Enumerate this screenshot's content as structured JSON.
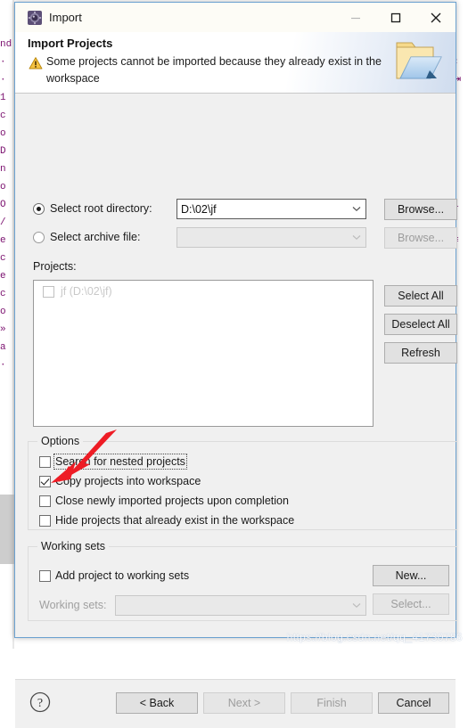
{
  "window": {
    "title": "Import",
    "icon": "eclipse-import-icon",
    "controls": {
      "minimize": "minimize-icon",
      "maximize": "maximize-icon",
      "close": "close-icon"
    }
  },
  "header": {
    "title": "Import Projects",
    "message": "Some projects cannot be imported because they already exist in the workspace",
    "warning_icon": "warning-triangle-icon",
    "banner_icon": "import-folder-icon"
  },
  "source": {
    "root_radio_label": "Select root directory:",
    "root_value": "D:\\02\\jf",
    "root_browse_label": "Browse...",
    "root_selected": true,
    "archive_radio_label": "Select archive file:",
    "archive_value": "",
    "archive_browse_label": "Browse...",
    "archive_selected": false,
    "archive_enabled": false
  },
  "projects": {
    "label": "Projects:",
    "items": [
      {
        "label": "jf (D:\\02\\jf)",
        "checked": false,
        "enabled": false
      }
    ],
    "buttons": {
      "select_all": "Select All",
      "deselect_all": "Deselect All",
      "refresh": "Refresh"
    }
  },
  "options": {
    "legend": "Options",
    "items": [
      {
        "label": "Search for nested projects",
        "checked": false,
        "focused": true
      },
      {
        "label": "Copy projects into workspace",
        "checked": true,
        "focused": false
      },
      {
        "label": "Close newly imported projects upon completion",
        "checked": false,
        "focused": false
      },
      {
        "label": "Hide projects that already exist in the workspace",
        "checked": false,
        "focused": false
      }
    ]
  },
  "working_sets": {
    "legend": "Working sets",
    "add_label": "Add project to working sets",
    "add_checked": false,
    "new_label": "New...",
    "sets_label": "Working sets:",
    "sets_value": "",
    "select_label": "Select...",
    "sets_enabled": false
  },
  "footer": {
    "help_icon": "help-question-icon",
    "buttons": [
      {
        "label": "< Back",
        "enabled": true
      },
      {
        "label": "Next >",
        "enabled": false
      },
      {
        "label": "Finish",
        "enabled": false
      },
      {
        "label": "Cancel",
        "enabled": true
      }
    ]
  },
  "annotation": {
    "arrow": "red-arrow-annotation",
    "color": "#ee1c25",
    "points_at": "Copy projects into workspace"
  },
  "watermark": {
    "text": "https://blog.csdn.net/qq_41730786"
  },
  "background": {
    "left_fragments": "nd\n·\n·\n1\nc\no\nD\nn\no\nO\n/\ne\nc\ne\nc\no\n»\na\n·",
    "right_fragments": "‹\n⇥\n \n \n \n \n \n \ni\n \n≡\n·"
  },
  "colors": {
    "dialog_border": "#6ba1d0",
    "dialog_bg": "#f0f0f0",
    "titlebar_bg": "#fdfcf6",
    "accent_warning": "#f2b705",
    "annotation_red": "#ee1c25"
  }
}
